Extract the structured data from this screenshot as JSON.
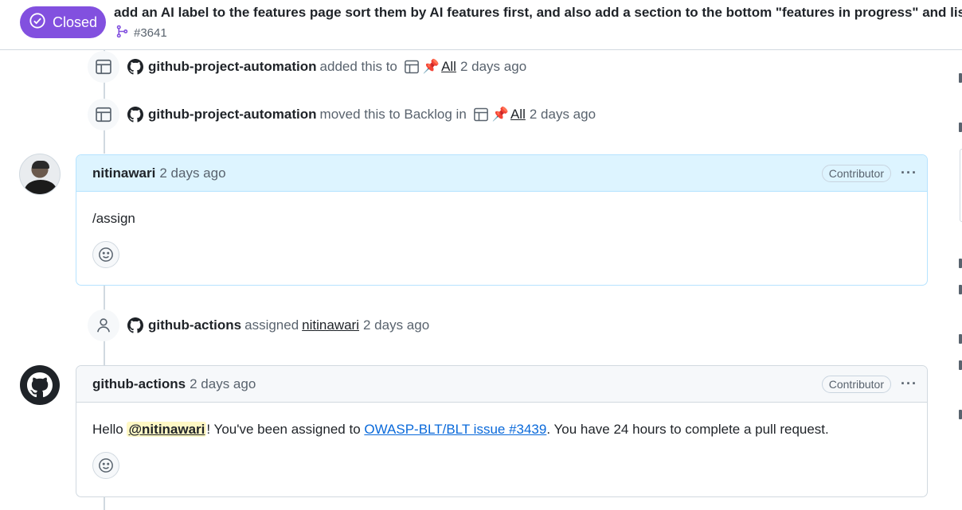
{
  "header": {
    "state": "Closed",
    "title": "add an AI label to the features page sort them by AI features first, and also add a section to the bottom \"features in progress\" and list",
    "issue_number": "#3641"
  },
  "timeline": {
    "event1": {
      "actor": "github-project-automation",
      "action": "added this to",
      "project": "All",
      "time": "2 days ago"
    },
    "event2": {
      "actor": "github-project-automation",
      "action": "moved this to Backlog in",
      "project": "All",
      "time": "2 days ago"
    },
    "comment1": {
      "author": "nitinawari",
      "time": "2 days ago",
      "role": "Contributor",
      "menu": "···",
      "body": "/assign"
    },
    "event3": {
      "actor": "github-actions",
      "action": "assigned",
      "assignee": "nitinawari",
      "time": "2 days ago"
    },
    "comment2": {
      "author": "github-actions",
      "time": "2 days ago",
      "role": "Contributor",
      "menu": "···",
      "body_prefix": "Hello ",
      "mention": "@nitinawari",
      "body_mid": "! You've been assigned to ",
      "link": "OWASP-BLT/BLT issue #3439",
      "body_suffix": ". You have 24 hours to complete a pull request."
    }
  },
  "icons": {
    "state": "issue-closed-icon",
    "branch": "git-branch-icon",
    "project": "table-icon",
    "pin": "pushpin-emoji",
    "person": "person-icon",
    "github": "github-mark-icon",
    "smiley": "smiley-icon"
  },
  "colors": {
    "closed": "#8250df",
    "link": "#0969da",
    "mention_bg": "#fff8c5",
    "author_header": "#ddf4ff"
  }
}
